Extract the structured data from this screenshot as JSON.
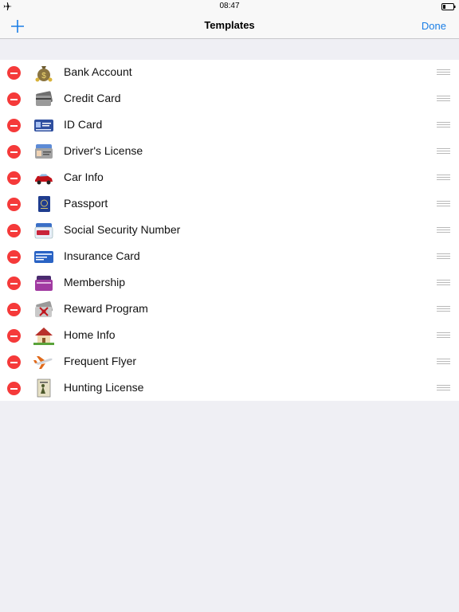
{
  "status_bar": {
    "time": "08:47"
  },
  "nav": {
    "title": "Templates",
    "done_label": "Done"
  },
  "colors": {
    "accent": "#1a7ee6",
    "delete": "#f53a3a",
    "background": "#efeff4"
  },
  "templates": [
    {
      "label": "Bank Account",
      "icon": "money-bag-icon"
    },
    {
      "label": "Credit Card",
      "icon": "credit-card-icon"
    },
    {
      "label": "ID Card",
      "icon": "id-card-icon"
    },
    {
      "label": "Driver's License",
      "icon": "drivers-license-icon"
    },
    {
      "label": "Car Info",
      "icon": "car-icon"
    },
    {
      "label": "Passport",
      "icon": "passport-icon"
    },
    {
      "label": "Social Security Number",
      "icon": "social-security-card-icon"
    },
    {
      "label": "Insurance Card",
      "icon": "insurance-card-icon"
    },
    {
      "label": "Membership",
      "icon": "membership-card-icon"
    },
    {
      "label": "Reward Program",
      "icon": "reward-card-icon"
    },
    {
      "label": "Home Info",
      "icon": "house-icon"
    },
    {
      "label": "Frequent Flyer",
      "icon": "airplane-icon"
    },
    {
      "label": "Hunting License",
      "icon": "hunting-license-icon"
    }
  ]
}
